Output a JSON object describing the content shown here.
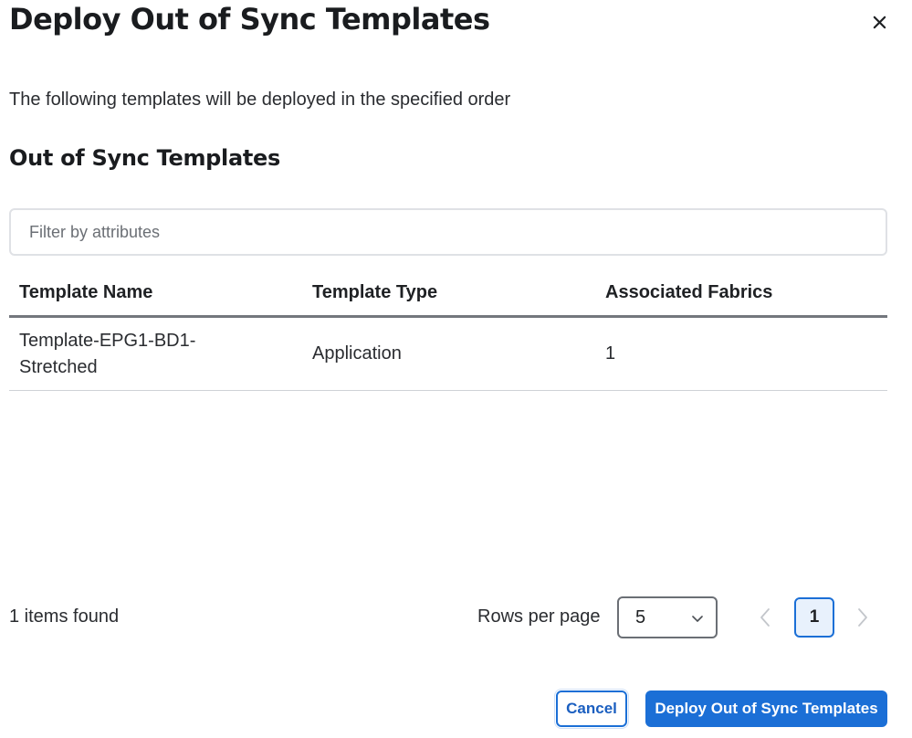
{
  "dialog": {
    "title": "Deploy Out of Sync Templates",
    "description": "The following templates will be deployed in the specified order",
    "section_title": "Out of Sync Templates"
  },
  "filter": {
    "placeholder": "Filter by attributes",
    "value": ""
  },
  "table": {
    "columns": [
      "Template Name",
      "Template Type",
      "Associated Fabrics"
    ],
    "rows": [
      {
        "template_name": "Template-EPG1-BD1-Stretched",
        "template_type": "Application",
        "associated_fabrics": "1"
      }
    ]
  },
  "footer": {
    "items_found": "1 items found",
    "rows_per_page_label": "Rows per page",
    "rows_per_page_value": "5",
    "current_page": "1"
  },
  "actions": {
    "cancel_label": "Cancel",
    "deploy_label": "Deploy Out of Sync Templates"
  },
  "icons": {
    "close": "close-icon",
    "select_chevron": "chevron-down-icon",
    "prev": "chevron-left-icon",
    "next": "chevron-right-icon"
  },
  "colors": {
    "primary": "#1b6fd6",
    "active_page_bg": "#e8f1fc"
  }
}
